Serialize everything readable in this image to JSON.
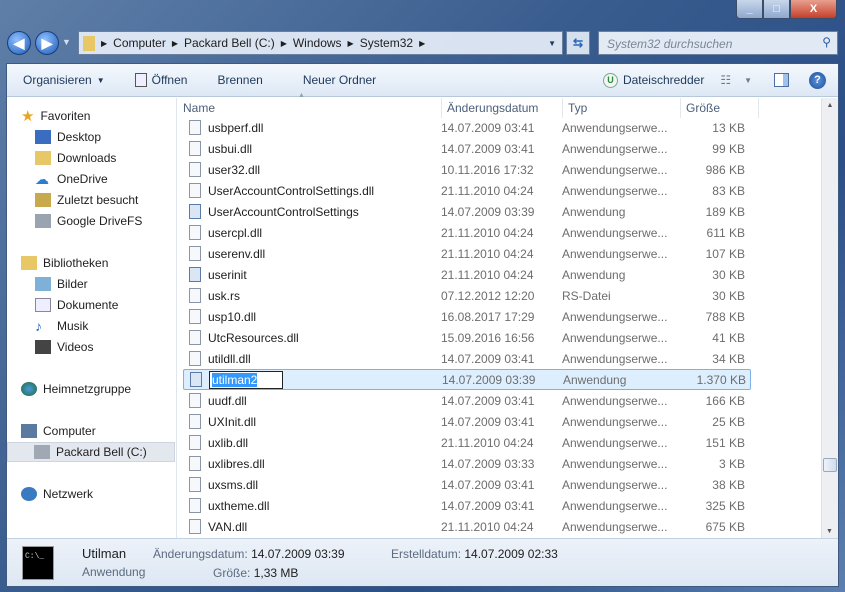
{
  "window": {
    "minimize": "_",
    "maximize": "□",
    "close": "X"
  },
  "address": {
    "crumbs": [
      "Computer",
      "Packard Bell (C:)",
      "Windows",
      "System32"
    ]
  },
  "search": {
    "placeholder": "System32 durchsuchen"
  },
  "toolbar": {
    "organize": "Organisieren",
    "open": "Öffnen",
    "burn": "Brennen",
    "new_folder": "Neuer Ordner",
    "shredder": "Dateischredder"
  },
  "sidebar": {
    "favorites": "Favoriten",
    "fav_items": [
      "Desktop",
      "Downloads",
      "OneDrive",
      "Zuletzt besucht",
      "Google DriveFS"
    ],
    "libraries": "Bibliotheken",
    "lib_items": [
      "Bilder",
      "Dokumente",
      "Musik",
      "Videos"
    ],
    "homegroup": "Heimnetzgruppe",
    "computer": "Computer",
    "drive": "Packard Bell (C:)",
    "network": "Netzwerk"
  },
  "columns": [
    "Name",
    "Änderungsdatum",
    "Typ",
    "Größe"
  ],
  "files": [
    [
      "usbperf.dll",
      "14.07.2009 03:41",
      "Anwendungserwe...",
      "13 KB"
    ],
    [
      "usbui.dll",
      "14.07.2009 03:41",
      "Anwendungserwe...",
      "99 KB"
    ],
    [
      "user32.dll",
      "10.11.2016 17:32",
      "Anwendungserwe...",
      "986 KB"
    ],
    [
      "UserAccountControlSettings.dll",
      "21.11.2010 04:24",
      "Anwendungserwe...",
      "83 KB"
    ],
    [
      "UserAccountControlSettings",
      "14.07.2009 03:39",
      "Anwendung",
      "189 KB"
    ],
    [
      "usercpl.dll",
      "21.11.2010 04:24",
      "Anwendungserwe...",
      "611 KB"
    ],
    [
      "userenv.dll",
      "21.11.2010 04:24",
      "Anwendungserwe...",
      "107 KB"
    ],
    [
      "userinit",
      "21.11.2010 04:24",
      "Anwendung",
      "30 KB"
    ],
    [
      "usk.rs",
      "07.12.2012 12:20",
      "RS-Datei",
      "30 KB"
    ],
    [
      "usp10.dll",
      "16.08.2017 17:29",
      "Anwendungserwe...",
      "788 KB"
    ],
    [
      "UtcResources.dll",
      "15.09.2016 16:56",
      "Anwendungserwe...",
      "41 KB"
    ],
    [
      "utildll.dll",
      "14.07.2009 03:41",
      "Anwendungserwe...",
      "34 KB"
    ],
    [
      "utilman2",
      "14.07.2009 03:39",
      "Anwendung",
      "1.370 KB"
    ],
    [
      "uudf.dll",
      "14.07.2009 03:41",
      "Anwendungserwe...",
      "166 KB"
    ],
    [
      "UXInit.dll",
      "14.07.2009 03:41",
      "Anwendungserwe...",
      "25 KB"
    ],
    [
      "uxlib.dll",
      "21.11.2010 04:24",
      "Anwendungserwe...",
      "151 KB"
    ],
    [
      "uxlibres.dll",
      "14.07.2009 03:33",
      "Anwendungserwe...",
      "3 KB"
    ],
    [
      "uxsms.dll",
      "14.07.2009 03:41",
      "Anwendungserwe...",
      "38 KB"
    ],
    [
      "uxtheme.dll",
      "14.07.2009 03:41",
      "Anwendungserwe...",
      "325 KB"
    ],
    [
      "VAN.dll",
      "21.11.2010 04:24",
      "Anwendungserwe...",
      "675 KB"
    ]
  ],
  "selected_index": 12,
  "details": {
    "name": "Utilman",
    "type": "Anwendung",
    "modified_label": "Änderungsdatum:",
    "modified": "14.07.2009 03:39",
    "created_label": "Erstelldatum:",
    "created": "14.07.2009 02:33",
    "size_label": "Größe:",
    "size": "1,33 MB",
    "icon_text": "C:\\_"
  }
}
